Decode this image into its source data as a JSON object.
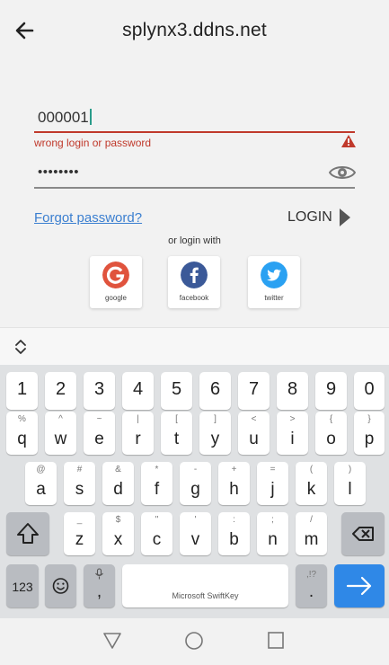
{
  "header": {
    "title": "splynx3.ddns.net"
  },
  "login": {
    "value": "000001",
    "error": "wrong login or password"
  },
  "password": {
    "value": "••••••••"
  },
  "links": {
    "forgot": "Forgot password?",
    "login": "LOGIN",
    "or_login_with": "or login with"
  },
  "social": [
    {
      "label": "google",
      "icon_text": "G",
      "color": "#e0533d"
    },
    {
      "label": "facebook",
      "icon_text": "f",
      "color": "#3b5998"
    },
    {
      "label": "twitter",
      "icon_text": "🐦",
      "color": "#2aa1f2"
    }
  ],
  "keyboard": {
    "numbers": [
      "1",
      "2",
      "3",
      "4",
      "5",
      "6",
      "7",
      "8",
      "9",
      "0"
    ],
    "row1": [
      [
        "%",
        "q"
      ],
      [
        "^",
        "w"
      ],
      [
        "~",
        "e"
      ],
      [
        "|",
        "r"
      ],
      [
        "[",
        "t"
      ],
      [
        "]",
        "y"
      ],
      [
        "<",
        "u"
      ],
      [
        ">",
        "i"
      ],
      [
        "{",
        "o"
      ],
      [
        "}",
        "p"
      ]
    ],
    "row2": [
      [
        "@",
        "a"
      ],
      [
        "#",
        "s"
      ],
      [
        "&",
        "d"
      ],
      [
        "*",
        "f"
      ],
      [
        "-",
        "g"
      ],
      [
        "+",
        "h"
      ],
      [
        "=",
        "j"
      ],
      [
        "(",
        "k"
      ],
      [
        ")",
        "l"
      ]
    ],
    "row3": [
      [
        "_",
        "z"
      ],
      [
        "$",
        "x"
      ],
      [
        "\"",
        "c"
      ],
      [
        "'",
        "v"
      ],
      [
        ":",
        "b"
      ],
      [
        ";",
        "n"
      ],
      [
        "/",
        "m"
      ]
    ],
    "bottom": {
      "num_key": "123",
      "space_label": "Microsoft SwiftKey",
      "comma": ",",
      "period": ".",
      "period_sub": ",!?"
    }
  },
  "colors": {
    "error": "#c0392b",
    "link": "#3b7fd0",
    "enter": "#2f88e7"
  }
}
